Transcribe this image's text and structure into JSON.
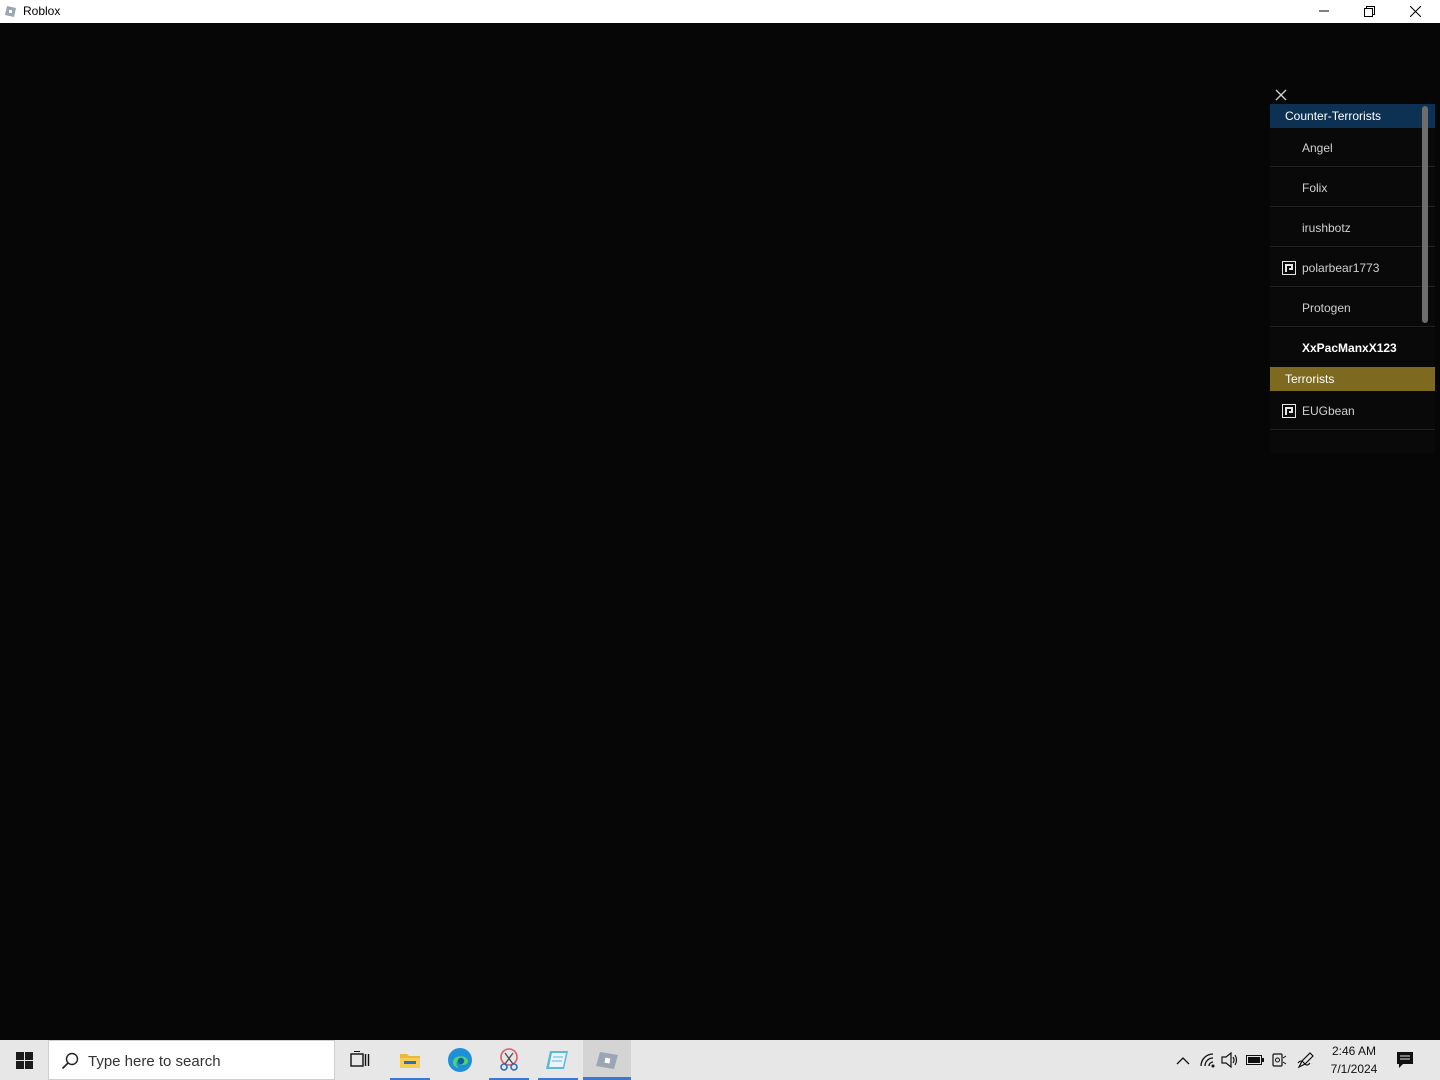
{
  "window": {
    "title": "Roblox",
    "icons": {
      "app": "roblox-icon",
      "minimize": "minimize-icon",
      "restore": "restore-icon",
      "close": "close-icon"
    }
  },
  "playerlist": {
    "close_icon": "close-icon",
    "teams": [
      {
        "name": "Counter-Terrorists",
        "color": "#0c3152",
        "players": [
          "Angel",
          "Folix",
          "irushbotz",
          "polarbear1773",
          "Protogen",
          "XxPacManxX123"
        ]
      },
      {
        "name": "Terrorists",
        "color": "#7d6a20",
        "players": [
          "EUGbean"
        ]
      }
    ],
    "premium_badge_players": [
      "polarbear1773",
      "EUGbean"
    ],
    "local_player": "XxPacManxX123"
  },
  "taskbar": {
    "search_placeholder": "Type here to search",
    "apps": [
      "task-view-icon",
      "file-explorer-icon",
      "edge-icon",
      "snipping-tool-icon",
      "notepad-icon",
      "roblox-icon"
    ],
    "tray_icons": [
      "chevron-up-icon",
      "wifi-icon",
      "volume-icon",
      "battery-icon",
      "camera-icon",
      "pen-icon"
    ],
    "time": "2:46 AM",
    "date": "7/1/2024",
    "accent": "#3a78d4"
  }
}
